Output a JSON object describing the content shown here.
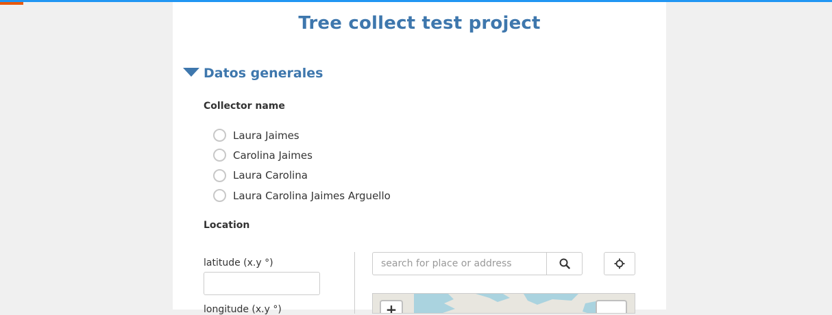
{
  "form": {
    "title": "Tree collect test project",
    "progress_percent": 2.8
  },
  "group": {
    "title": "Datos generales",
    "caret_icon": "caret-down-icon"
  },
  "collector": {
    "label": "Collector name",
    "options": [
      "Laura Jaimes",
      "Carolina Jaimes",
      "Laura Carolina",
      "Laura Carolina Jaimes Arguello"
    ]
  },
  "location": {
    "label": "Location",
    "latitude_label": "latitude (x.y °)",
    "latitude_value": "",
    "longitude_label": "longitude (x.y °)",
    "search_placeholder": "search for place or address",
    "search_icon": "search-icon",
    "locate_icon": "crosshair-icon",
    "zoom_in_label": "+"
  },
  "colors": {
    "accent": "#3e77ad",
    "top_bar": "#2196f3",
    "progress": "#e8590c",
    "water": "#aad3df"
  }
}
